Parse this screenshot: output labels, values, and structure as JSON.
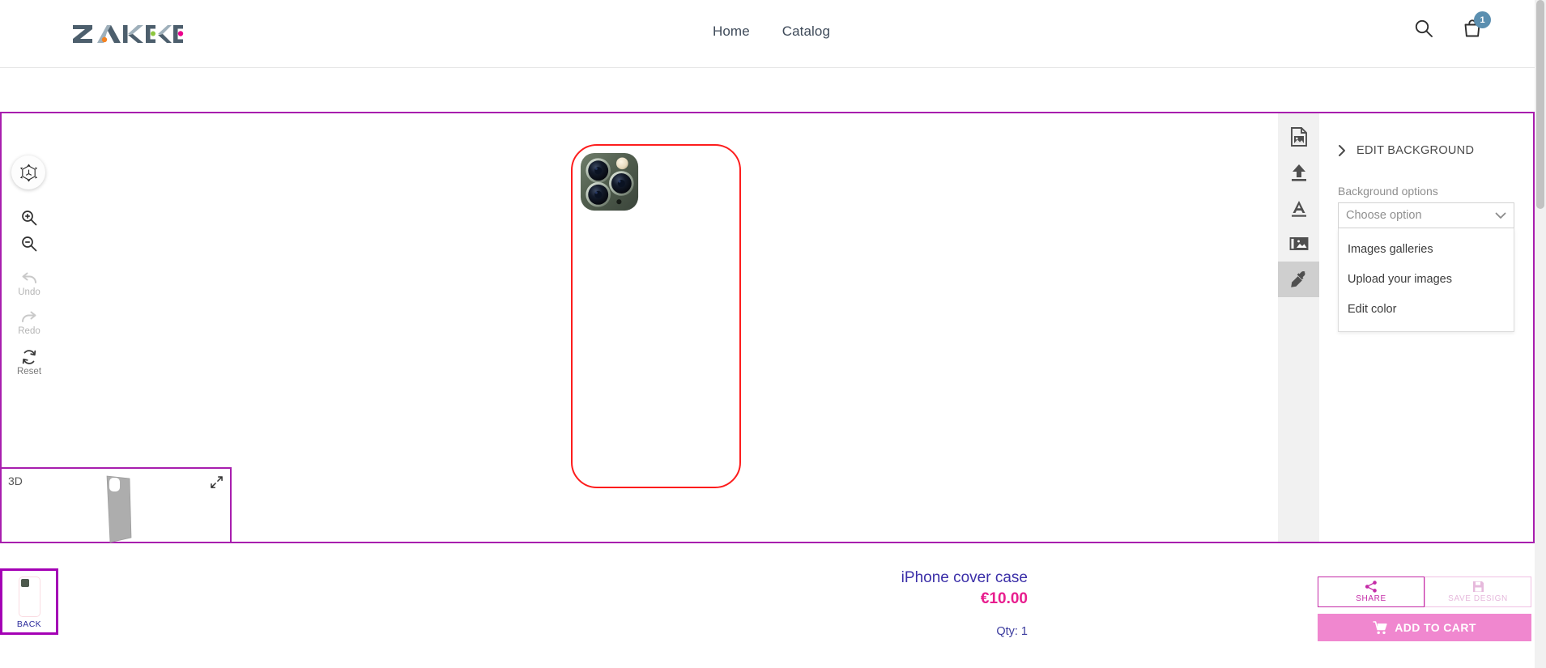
{
  "header": {
    "brand": "ZAKEKE",
    "nav": [
      {
        "label": "Home"
      },
      {
        "label": "Catalog"
      }
    ],
    "search_icon": "search-icon",
    "cart_icon": "shopping-bag-icon",
    "cart_count": "1"
  },
  "left_rail": {
    "rotate_3d": "3d-rotate-icon",
    "zoom_in": "zoom-in-icon",
    "zoom_out": "zoom-out-icon",
    "undo_label": "Undo",
    "redo_label": "Redo",
    "reset_label": "Reset"
  },
  "preview_3d": {
    "label": "3D",
    "expand_icon": "expand-icon"
  },
  "tool_strip": {
    "items": [
      {
        "name": "image-file-icon",
        "active": false
      },
      {
        "name": "upload-icon",
        "active": false
      },
      {
        "name": "text-icon",
        "active": false
      },
      {
        "name": "gallery-icon",
        "active": false
      },
      {
        "name": "eyedropper-icon",
        "active": true
      }
    ]
  },
  "options_panel": {
    "section_title": "EDIT BACKGROUND",
    "chevron": "chevron-right-icon",
    "field_label": "Background options",
    "select_value": "Choose option",
    "select_chevron": "chevron-down-icon",
    "dropdown_options": [
      {
        "label": "Images galleries"
      },
      {
        "label": "Upload your images"
      },
      {
        "label": "Edit color"
      }
    ]
  },
  "side_thumbnails": [
    {
      "label": "BACK",
      "selected": true
    }
  ],
  "product": {
    "title": "iPhone cover case",
    "price": "€10.00",
    "qty": "Qty: 1"
  },
  "actions": {
    "share_label": "SHARE",
    "share_icon": "share-icon",
    "save_label": "SAVE DESIGN",
    "save_icon": "save-disk-icon",
    "add_to_cart_label": "ADD TO CART",
    "cart_icon": "cart-icon"
  },
  "colors": {
    "frame_magenta": "#a81eae",
    "accent_pink": "#e81d8e",
    "button_pink": "#f087cf",
    "title_indigo": "#3b2fa8",
    "outline_red": "#fd1d1d",
    "badge_blue": "#5b8fb0"
  }
}
